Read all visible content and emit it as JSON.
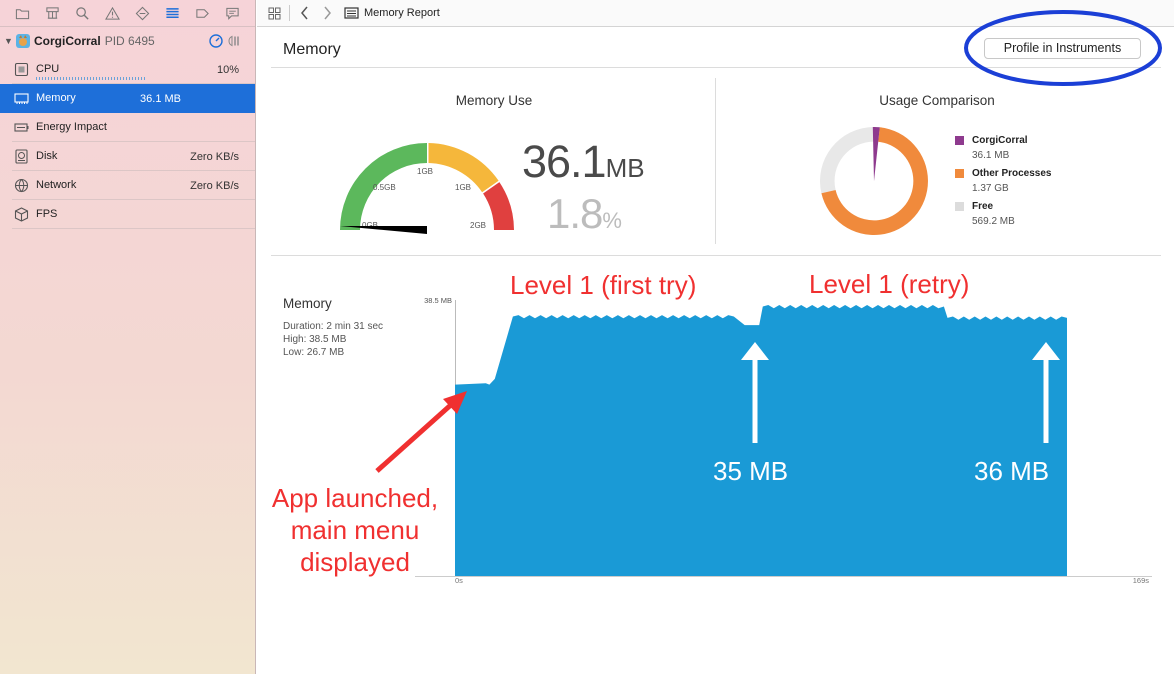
{
  "sidebar": {
    "nav_icons": [
      "folder-icon",
      "hierarchy-icon",
      "search-icon",
      "warning-icon",
      "breakpoint-diamond-icon",
      "debug-navigator-icon",
      "tag-icon",
      "chat-bubble-icon"
    ],
    "process": {
      "name": "CorgiCorral",
      "pid": "PID 6495"
    },
    "gauges": [
      {
        "id": "cpu",
        "label": "CPU",
        "value": "10%",
        "icon": "cpu-chip-icon"
      },
      {
        "id": "memory",
        "label": "Memory",
        "value": "36.1 MB",
        "icon": "memory-chip-icon",
        "selected": true
      },
      {
        "id": "energy",
        "label": "Energy Impact",
        "value": "",
        "icon": "battery-icon"
      },
      {
        "id": "disk",
        "label": "Disk",
        "value": "Zero KB/s",
        "icon": "disk-icon"
      },
      {
        "id": "network",
        "label": "Network",
        "value": "Zero KB/s",
        "icon": "network-globe-icon"
      },
      {
        "id": "fps",
        "label": "FPS",
        "value": "",
        "icon": "fps-cube-icon"
      }
    ]
  },
  "jump_bar": {
    "title": "Memory Report"
  },
  "report": {
    "title": "Memory",
    "profile_button": "Profile in Instruments",
    "memory_use": {
      "title": "Memory Use",
      "value": "36.1",
      "unit": "MB",
      "percent": "1.8",
      "percent_unit": "%",
      "ticks": [
        "0GB",
        "0.5GB",
        "1GB",
        "1GB",
        "2GB"
      ],
      "needle_fraction": 0.009
    },
    "usage_comparison": {
      "title": "Usage Comparison",
      "legend": [
        {
          "name": "CorgiCorral",
          "value": "36.1 MB",
          "color": "#8e3a8e"
        },
        {
          "name": "Other Processes",
          "value": "1.37 GB",
          "color": "#f08a3c"
        },
        {
          "name": "Free",
          "value": "569.2 MB",
          "color": "#e8e8e8"
        }
      ]
    },
    "timeline": {
      "title": "Memory",
      "duration": "Duration: 2 min 31 sec",
      "high": "High: 38.5 MB",
      "low": "Low: 26.7 MB"
    }
  },
  "chart_data": {
    "type": "area",
    "title": "Memory",
    "y_max_label": "38.5 MB",
    "x_start_label": "0s",
    "x_end_label": "169s",
    "xlim": [
      0,
      169
    ],
    "ylim": [
      0,
      38.5
    ],
    "fill_color": "#1a9ad6",
    "x": [
      0,
      8.5,
      9.5,
      11,
      16,
      77,
      80,
      84,
      85,
      135,
      136,
      169
    ],
    "values": [
      26.7,
      26.9,
      26.7,
      27.5,
      36.2,
      36.2,
      35.0,
      35.0,
      37.6,
      37.6,
      36.0,
      36.0
    ]
  },
  "annotations": {
    "level1_first": "Level 1 (first try)",
    "level1_retry": "Level 1 (retry)",
    "mb35": "35 MB",
    "mb36": "36 MB",
    "app_launch": "App launched, main menu displayed"
  }
}
